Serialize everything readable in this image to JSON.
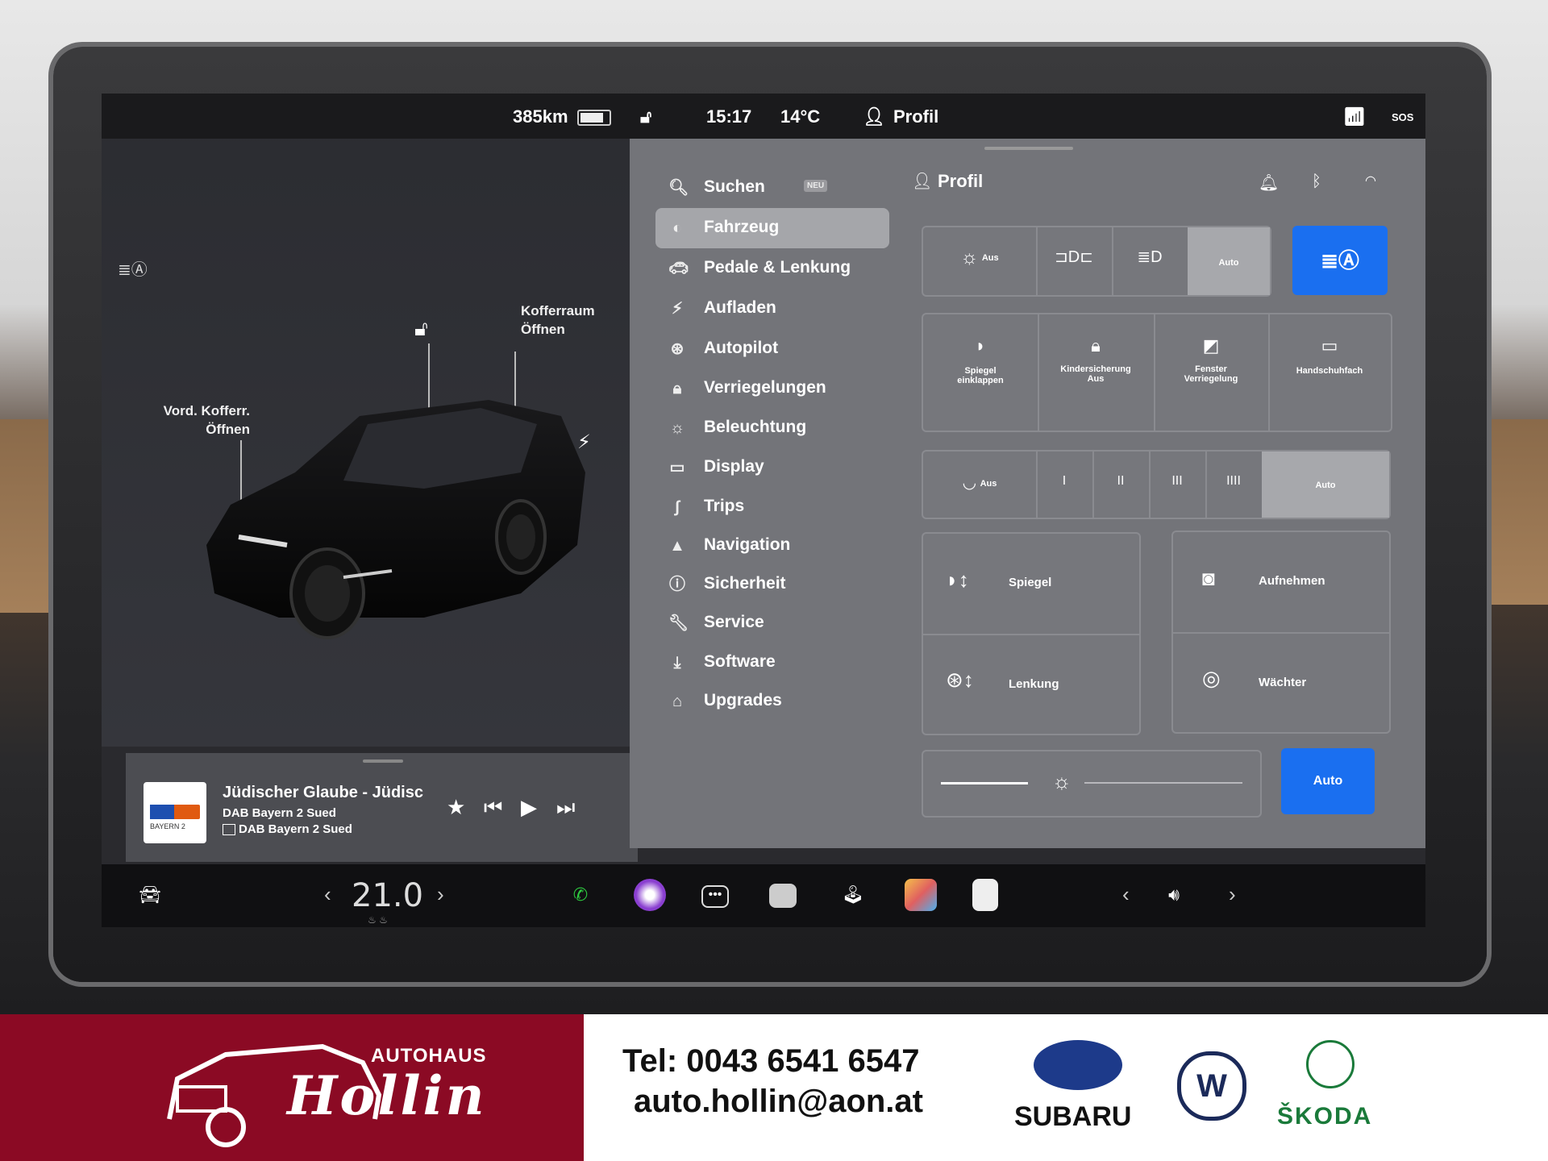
{
  "status_bar": {
    "range": "385km",
    "time": "15:17",
    "temperature": "14°C",
    "profile": "Profil",
    "sos": "SOS"
  },
  "car_view": {
    "front_trunk_label_1": "Vord. Kofferr.",
    "front_trunk_label_2": "Öffnen",
    "trunk_label_1": "Kofferraum",
    "trunk_label_2": "Öffnen"
  },
  "media": {
    "title": "Jüdischer Glaube - Jüdisc",
    "station": "DAB Bayern 2 Sued",
    "source": "DAB Bayern 2 Sued",
    "album_art_text": "BAYERN 2"
  },
  "menu": {
    "search_label": "Suchen",
    "search_badge": "NEU",
    "items": [
      {
        "label": "Fahrzeug",
        "icon": "toggle-icon"
      },
      {
        "label": "Pedale & Lenkung",
        "icon": "car-icon"
      },
      {
        "label": "Aufladen",
        "icon": "bolt-icon"
      },
      {
        "label": "Autopilot",
        "icon": "steering-wheel-icon"
      },
      {
        "label": "Verriegelungen",
        "icon": "lock-icon"
      },
      {
        "label": "Beleuchtung",
        "icon": "sun-icon"
      },
      {
        "label": "Display",
        "icon": "display-icon"
      },
      {
        "label": "Trips",
        "icon": "trips-icon"
      },
      {
        "label": "Navigation",
        "icon": "navigation-icon"
      },
      {
        "label": "Sicherheit",
        "icon": "safety-icon"
      },
      {
        "label": "Service",
        "icon": "wrench-icon"
      },
      {
        "label": "Software",
        "icon": "download-icon"
      },
      {
        "label": "Upgrades",
        "icon": "bag-icon"
      }
    ]
  },
  "settings": {
    "profile_title": "Profil",
    "lights": {
      "off": "Aus",
      "auto": "Auto"
    },
    "quick": {
      "mirror_fold_1": "Spiegel",
      "mirror_fold_2": "einklappen",
      "child_lock_1": "Kindersicherung",
      "child_lock_2": "Aus",
      "window_lock_1": "Fenster",
      "window_lock_2": "Verriegelung",
      "glovebox": "Handschuhfach"
    },
    "wipers": {
      "off": "Aus",
      "s1": "I",
      "s2": "II",
      "s3": "III",
      "s4": "IIII",
      "auto": "Auto"
    },
    "tiles": {
      "mirror": "Spiegel",
      "steering": "Lenkung",
      "record": "Aufnehmen",
      "sentry": "Wächter"
    },
    "brightness": {
      "auto": "Auto",
      "level": 0.45
    }
  },
  "dock": {
    "temperature": "21.0"
  },
  "footer": {
    "auto_word": "AUTOHAUS",
    "brand": "Hollin",
    "tel": "Tel: 0043 6541 6547",
    "email": "auto.hollin@aon.at",
    "subaru": "SUBARU",
    "skoda": "ŠKODA"
  },
  "colors": {
    "accent_blue": "#1a6ff0",
    "banner_red": "#8b0a24"
  }
}
